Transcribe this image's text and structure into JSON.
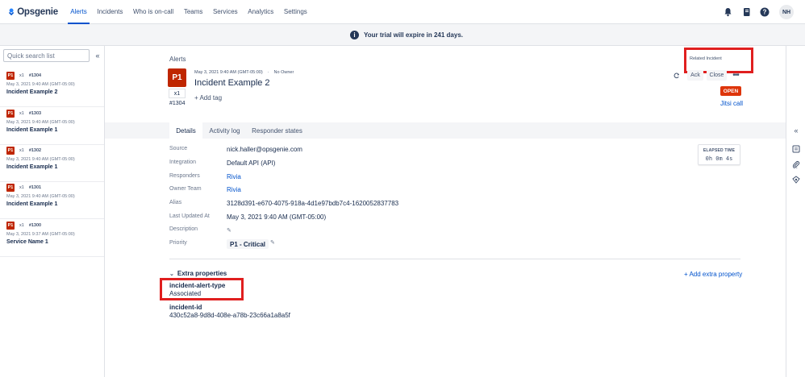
{
  "app": {
    "logo_text": "Opsgenie"
  },
  "nav": {
    "items": [
      {
        "label": "Alerts",
        "active": true
      },
      {
        "label": "Incidents"
      },
      {
        "label": "Who is on-call"
      },
      {
        "label": "Teams"
      },
      {
        "label": "Services"
      },
      {
        "label": "Analytics"
      },
      {
        "label": "Settings"
      }
    ],
    "icons": [
      "bell-icon",
      "book-icon",
      "help-icon"
    ],
    "avatar": "NH"
  },
  "banner": {
    "icon": "info-icon",
    "text": "Your trial will expire in 241 days."
  },
  "sidebar": {
    "search_placeholder": "Quick search list",
    "alerts": [
      {
        "priority": "P1",
        "count": "x1",
        "tiny": "#1304",
        "date": "May 3, 2021 9:40 AM (GMT-05:00)",
        "title": "Incident Example 2"
      },
      {
        "priority": "P1",
        "count": "x1",
        "tiny": "#1303",
        "date": "May 3, 2021 9:40 AM (GMT-05:00)",
        "title": "Incident Example 1"
      },
      {
        "priority": "P1",
        "count": "x1",
        "tiny": "#1302",
        "date": "May 3, 2021 9:40 AM (GMT-05:00)",
        "title": "Incident Example 1"
      },
      {
        "priority": "P1",
        "count": "x1",
        "tiny": "#1301",
        "date": "May 3, 2021 9:40 AM (GMT-05:00)",
        "title": "Incident Example 1"
      },
      {
        "priority": "P1",
        "count": "x1",
        "tiny": "#1300",
        "date": "May 3, 2021 9:37 AM (GMT-05:00)",
        "title": "Service Name 1"
      }
    ]
  },
  "detail": {
    "breadcrumb": "Alerts",
    "priority": "P1",
    "count": "x1",
    "tiny_id": "#1304",
    "date": "May 3, 2021 9:40 AM (GMT-05:00)",
    "owner": "No Owner",
    "title": "Incident Example 2",
    "add_tag": "+ Add tag",
    "related_incident": "Related Incident",
    "ack": "Ack",
    "close": "Close",
    "status": "OPEN",
    "jitsi": "Jitsi call",
    "tabs": [
      "Details",
      "Activity log",
      "Responder states"
    ],
    "fields": {
      "source": {
        "label": "Source",
        "value": "nick.haller@opsgenie.com"
      },
      "integration": {
        "label": "Integration",
        "value": "Default API (API)"
      },
      "responders": {
        "label": "Responders",
        "value": "Rivia"
      },
      "owner_team": {
        "label": "Owner Team",
        "value": "Rivia"
      },
      "alias": {
        "label": "Alias",
        "value": "3128d391-e670-4075-918a-4d1e97bdb7c4-1620052837783"
      },
      "last_updated": {
        "label": "Last Updated At",
        "value": "May 3, 2021 9:40 AM (GMT-05:00)"
      },
      "description": {
        "label": "Description"
      },
      "priority": {
        "label": "Priority",
        "value": "P1 - Critical"
      }
    },
    "elapsed": {
      "label": "ELAPSED TIME",
      "value": "0h 0m 4s"
    },
    "extra": {
      "header": "Extra properties",
      "add": "+ Add extra property",
      "props": [
        {
          "key": "incident-alert-type",
          "value": "Associated"
        },
        {
          "key": "incident-id",
          "value": "430c52a8-9d8d-408e-a78b-23c66a1a8a5f"
        }
      ]
    }
  },
  "rail": {
    "icons": [
      "collapse-icon",
      "notes-icon",
      "attachment-icon",
      "runbook-icon"
    ]
  },
  "colors": {
    "accent": "#0052cc",
    "priority": "#bf2600",
    "open": "#de350b",
    "highlight": "#e01f1f"
  }
}
